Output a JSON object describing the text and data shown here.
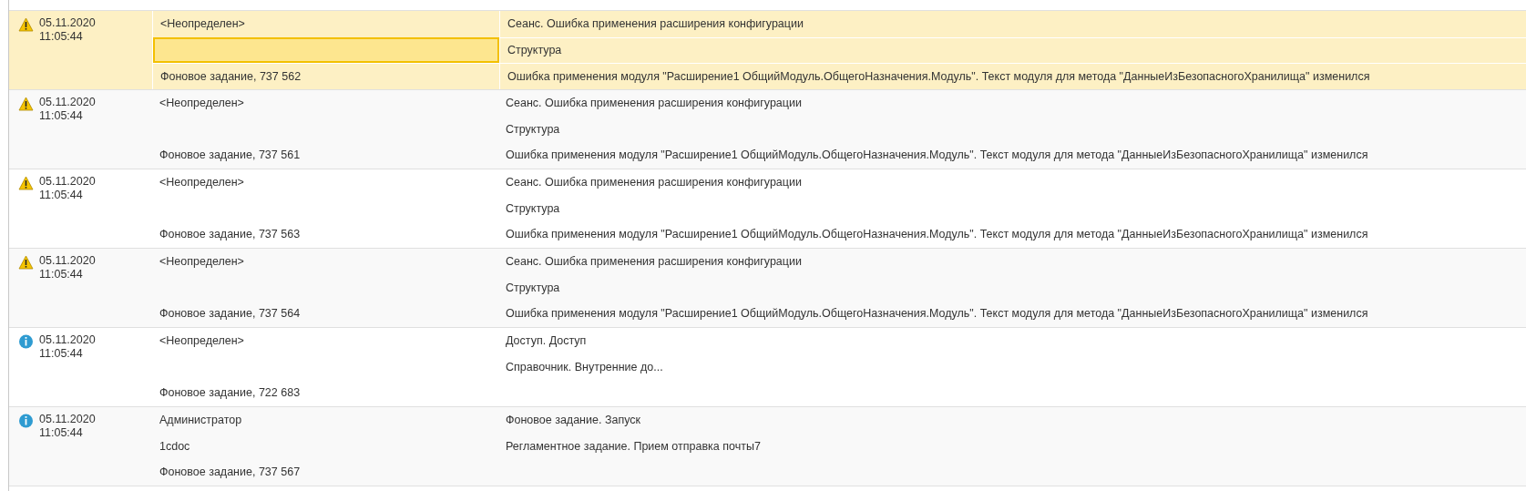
{
  "log": {
    "rows": [
      {
        "kind": "warning",
        "selected": true,
        "date": "05.11.2020",
        "time": "11:05:44",
        "user_lines": [
          {
            "text": "<Неопределен>",
            "focused": false
          },
          {
            "focused": true
          },
          {
            "text": "Фоновое задание, 737 562",
            "focused": false
          }
        ],
        "event_lines": [
          "Сеанс. Ошибка применения расширения конфигурации",
          "Структура",
          "Ошибка применения модуля \"Расширение1 ОбщийМодуль.ОбщегоНазначения.Модуль\". Текст модуля для метода \"ДанныеИзБезопасногоХранилища\" изменился"
        ]
      },
      {
        "kind": "warning",
        "selected": false,
        "date": "05.11.2020",
        "time": "11:05:44",
        "user_lines": [
          {
            "text": "<Неопределен>",
            "focused": false
          },
          {
            "focused": false
          },
          {
            "text": "Фоновое задание, 737 561",
            "focused": false
          }
        ],
        "event_lines": [
          "Сеанс. Ошибка применения расширения конфигурации",
          "Структура",
          "Ошибка применения модуля \"Расширение1 ОбщийМодуль.ОбщегоНазначения.Модуль\". Текст модуля для метода \"ДанныеИзБезопасногоХранилища\" изменился"
        ]
      },
      {
        "kind": "warning",
        "selected": false,
        "date": "05.11.2020",
        "time": "11:05:44",
        "user_lines": [
          {
            "text": "<Неопределен>",
            "focused": false
          },
          {
            "focused": false
          },
          {
            "text": "Фоновое задание, 737 563",
            "focused": false
          }
        ],
        "event_lines": [
          "Сеанс. Ошибка применения расширения конфигурации",
          "Структура",
          "Ошибка применения модуля \"Расширение1 ОбщийМодуль.ОбщегоНазначения.Модуль\". Текст модуля для метода \"ДанныеИзБезопасногоХранилища\" изменился"
        ]
      },
      {
        "kind": "warning",
        "selected": false,
        "date": "05.11.2020",
        "time": "11:05:44",
        "user_lines": [
          {
            "text": "<Неопределен>",
            "focused": false
          },
          {
            "focused": false
          },
          {
            "text": "Фоновое задание, 737 564",
            "focused": false
          }
        ],
        "event_lines": [
          "Сеанс. Ошибка применения расширения конфигурации",
          "Структура",
          "Ошибка применения модуля \"Расширение1 ОбщийМодуль.ОбщегоНазначения.Модуль\". Текст модуля для метода \"ДанныеИзБезопасногоХранилища\" изменился"
        ]
      },
      {
        "kind": "info",
        "selected": false,
        "date": "05.11.2020",
        "time": "11:05:44",
        "user_lines": [
          {
            "text": "<Неопределен>",
            "focused": false
          },
          {
            "focused": false
          },
          {
            "text": "Фоновое задание, 722 683",
            "focused": false
          }
        ],
        "event_lines": [
          "Доступ. Доступ",
          "Справочник. Внутренние до..."
        ]
      },
      {
        "kind": "info",
        "selected": false,
        "date": "05.11.2020",
        "time": "11:05:44",
        "user_lines": [
          {
            "text": "Администратор",
            "focused": false
          },
          {
            "text": "1cdoc",
            "focused": false
          },
          {
            "text": "Фоновое задание, 737 567",
            "focused": false
          }
        ],
        "event_lines": [
          "Фоновое задание. Запуск",
          "Регламентное задание. Прием отправка почты7"
        ]
      }
    ]
  }
}
